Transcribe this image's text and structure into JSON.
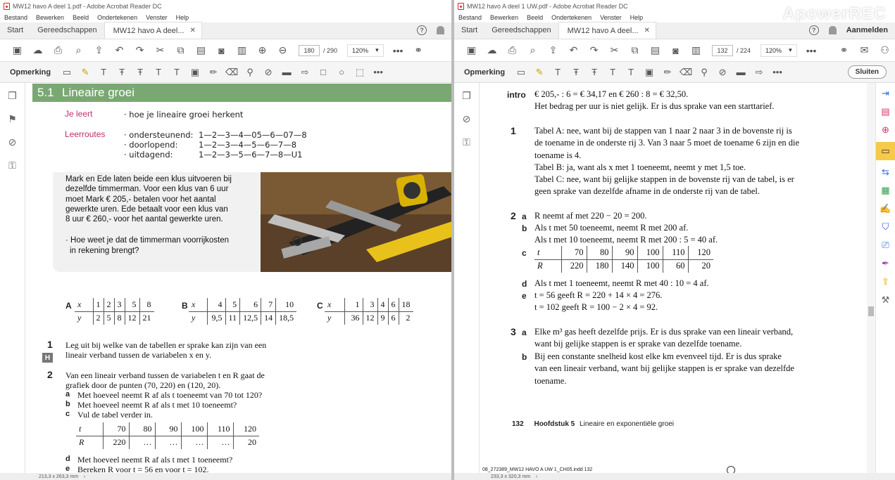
{
  "left": {
    "title": "MW12 havo A deel 1.pdf - Adobe Acrobat Reader DC",
    "menu": [
      "Bestand",
      "Bewerken",
      "Beeld",
      "Ondertekenen",
      "Venster",
      "Help"
    ],
    "tabs": {
      "start": "Start",
      "tools": "Gereedschappen",
      "doc": "MW12 havo A deel..."
    },
    "page_current": "180",
    "page_total": "/ 290",
    "zoom": "120%",
    "comment_label": "Opmerking",
    "status_size": "213,3 x 263,3 mm",
    "section_num": "5.1",
    "section_title": "Lineaire groei",
    "learn_label": "Je leert",
    "learn_text": "· hoe je lineaire groei herkent",
    "routes_label": "Leerroutes",
    "routes": [
      {
        "name": "· ondersteunend:",
        "path": "1—2—3—4—05—6—07—8"
      },
      {
        "name": "· doorlopend:",
        "path": "1—2—3—4—5—6—7—8"
      },
      {
        "name": "· uitdagend:",
        "path": "1—2—3—5—6—7—8—U1"
      }
    ],
    "intro_lines": [
      "Mark en Ede laten beide een klus uitvoeren bij",
      "dezelfde timmerman. Voor een klus van 6 uur",
      "moet Mark € 205,- betalen voor het aantal",
      "gewerkte uren. Ede betaalt voor een klus van",
      "8 uur € 260,- voor het aantal gewerkte uren."
    ],
    "intro_q": [
      "· Hoe weet je dat de timmerman voorrijkosten",
      "  in rekening brengt?"
    ],
    "tableA": {
      "label": "A",
      "x": [
        "1",
        "2",
        "3",
        "5",
        "8"
      ],
      "y": [
        "2",
        "5",
        "8",
        "12",
        "21"
      ]
    },
    "tableB": {
      "label": "B",
      "x": [
        "4",
        "5",
        "6",
        "7",
        "10"
      ],
      "y": [
        "9,5",
        "11",
        "12,5",
        "14",
        "18,5"
      ]
    },
    "tableC": {
      "label": "C",
      "x": [
        "1",
        "3",
        "4",
        "6",
        "18"
      ],
      "y": [
        "36",
        "12",
        "9",
        "6",
        "2"
      ]
    },
    "ex1_num": "1",
    "ex1_badge": "H",
    "ex1_lines": [
      "Leg uit bij welke van de tabellen er sprake kan zijn van een",
      "lineair verband tussen de variabelen x en y."
    ],
    "ex2_num": "2",
    "ex2_lines": [
      "Van een lineair verband tussen de variabelen t en R gaat de",
      "grafiek door de punten (70, 220) en (120, 20)."
    ],
    "ex2_subs": [
      {
        "l": "a",
        "t": "Met hoeveel neemt R af als t toeneemt van 70 tot 120?"
      },
      {
        "l": "b",
        "t": "Met hoeveel neemt R af als t met 10 toeneemt?"
      },
      {
        "l": "c",
        "t": "Vul de tabel verder in."
      }
    ],
    "ex2_table": {
      "t": [
        "70",
        "80",
        "90",
        "100",
        "110",
        "120"
      ],
      "R": [
        "220",
        "…",
        "…",
        "…",
        "…",
        "20"
      ]
    },
    "ex2_subs2": [
      {
        "l": "d",
        "t": "Met hoeveel neemt R af als t met 1 toeneemt?"
      },
      {
        "l": "e",
        "t": "Bereken R voor t = 56 en voor t = 102."
      }
    ]
  },
  "right": {
    "title": "MW12 havo A deel 1 UW.pdf - Adobe Acrobat Reader DC",
    "menu": [
      "Bestand",
      "Bewerken",
      "Beeld",
      "Ondertekenen",
      "Venster",
      "Help"
    ],
    "tabs": {
      "start": "Start",
      "tools": "Gereedschappen",
      "doc": "MW12 havo A deel..."
    },
    "signin": "Aanmelden",
    "page_current": "132",
    "page_total": "/ 224",
    "zoom": "120%",
    "comment_label": "Opmerking",
    "close_label": "Sluiten",
    "status_size": "233,3 x 320,3 mm",
    "watermark": "ApowerREC",
    "intro_label": "intro",
    "intro_lines": [
      "€ 205,- : 6 = € 34,17 en € 260 : 8 = € 32,50.",
      "Het bedrag per uur is niet gelijk. Er is dus sprake van een starttarief."
    ],
    "a1_num": "1",
    "a1_lines": [
      "Tabel A: nee, want bij de stappen van 1 naar 2 naar 3 in de bovenste rij is",
      "de toename in de onderste rij 3. Van 3 naar 5 moet de toename 6 zijn en die",
      "toename is 4.",
      "Tabel B: ja, want als x met 1 toeneemt, neemt y met 1,5 toe.",
      "Tabel C: nee, want bij gelijke stappen in de bovenste rij van de tabel, is er",
      "geen sprake van dezelfde afname in de onderste rij van de tabel."
    ],
    "a2_num": "2",
    "a2a": "R neemt af met 220 − 20 = 200.",
    "a2b": [
      "Als t met 50 toeneemt, neemt R met 200 af.",
      "Als t met 10 toeneemt, neemt R met 200 : 5 = 40 af."
    ],
    "a2_table": {
      "t": [
        "70",
        "80",
        "90",
        "100",
        "110",
        "120"
      ],
      "R": [
        "220",
        "180",
        "140",
        "100",
        "60",
        "20"
      ]
    },
    "a2d": "Als t met 1 toeneemt, neemt R met 40 : 10 = 4 af.",
    "a2e": [
      "t = 56 geeft R = 220 + 14 × 4 = 276.",
      "t = 102 geeft R = 100 − 2 × 4 = 92."
    ],
    "a3_num": "3",
    "a3a": [
      "Elke m³ gas heeft dezelfde prijs. Er is dus sprake van een lineair verband,",
      "want bij gelijke stappen is er sprake van dezelfde toename."
    ],
    "a3b": [
      "Bij een constante snelheid kost elke km evenveel tijd. Er is dus sprake",
      "van een lineair verband, want bij gelijke stappen is er sprake van dezelfde",
      "toename."
    ],
    "footer_page": "132",
    "footer_chapter": "Hoofdstuk 5",
    "footer_title": "Lineaire en exponentiële groei",
    "file_line": "08_272389_MW12 HAVO A UW 1_CH05.indd   132"
  },
  "letters": [
    "a",
    "b",
    "c",
    "d",
    "e"
  ],
  "colors": {
    "section": "#7aa873",
    "learn": "#c0306a",
    "highlight": "#f7c948"
  }
}
